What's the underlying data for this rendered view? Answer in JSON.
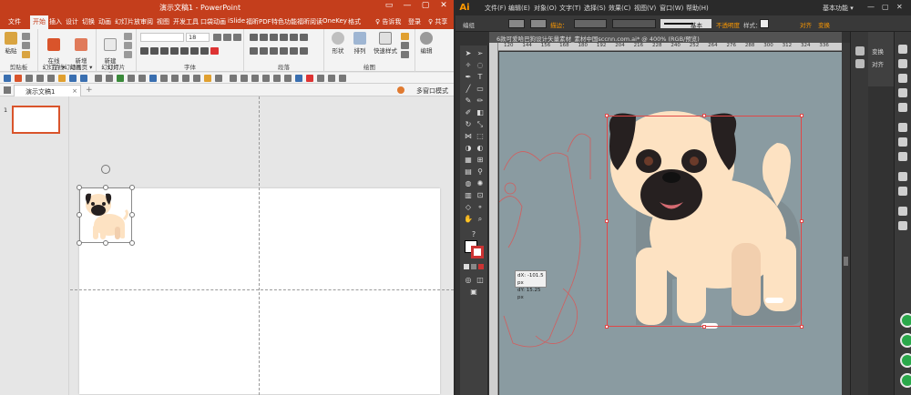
{
  "ppt": {
    "title": "演示文稿1 - PowerPoint",
    "title_controls": [
      "▭",
      "—",
      "▢",
      "✕"
    ],
    "menu": [
      "文件",
      "开始",
      "插入",
      "设计",
      "切换",
      "动画",
      "幻灯片放",
      "审阅",
      "视图",
      "开发工具",
      "口袋动画",
      "iSlide",
      "福昕PDF",
      "特色功能",
      "福昕阅读",
      "OneKey",
      "格式"
    ],
    "tell_me": "♀ 告诉我",
    "login": "登录",
    "share": "♀ 共享",
    "ribbon": {
      "paste": "粘贴",
      "clipboard": "剪贴板",
      "online_slide": "在线\n幻灯片 ▾",
      "online_anim": "新增\n动画页 ▾",
      "online_group": "在线幻灯片",
      "new_slide": "新建\n幻灯片 ▾",
      "slides_group": "幻灯片",
      "font_name": "",
      "font_size": "18",
      "font_group": "字体",
      "para_group": "段落",
      "shape": "形状",
      "arrange": "排列",
      "quick_style": "快速样式",
      "drawing_group": "绘图",
      "edit": "编辑"
    },
    "tab": {
      "label": "演示文稿1",
      "close": "×",
      "add": "+",
      "multi_window": "多窗口模式"
    },
    "thumb_number": "1"
  },
  "ai": {
    "logo": "Ai",
    "menu": [
      "文件(F)",
      "编辑(E)",
      "对象(O)",
      "文字(T)",
      "选择(S)",
      "效果(C)",
      "视图(V)",
      "窗口(W)",
      "帮助(H)"
    ],
    "workspace": "基本功能 ▾",
    "control": {
      "group": "编组",
      "stroke_label": "描边：",
      "stroke_style": "基本",
      "opacity": "不透明度",
      "style": "样式：",
      "align": "对齐",
      "transform": "变换"
    },
    "doc_tab": "6款可爱哈巴狗设计矢量素材_素材中国sccnn.com.ai* @ 400% (RGB/预览)",
    "ruler_ticks": [
      "120",
      "144",
      "156",
      "168",
      "180",
      "192",
      "204",
      "216",
      "228",
      "240",
      "252",
      "264",
      "276",
      "288",
      "300",
      "312",
      "324",
      "336"
    ],
    "panels": {
      "transform": "变换",
      "align": "对齐"
    },
    "readout": {
      "dx": "dX: -101.5 px",
      "dy": "dY: 15.25 px"
    }
  },
  "colors": {
    "ppt_accent": "#c43e1c",
    "ai_canvas": "#8a9ba1",
    "pug_fur": "#fde2c2",
    "pug_dark": "#262020",
    "selection": "#e04848"
  }
}
